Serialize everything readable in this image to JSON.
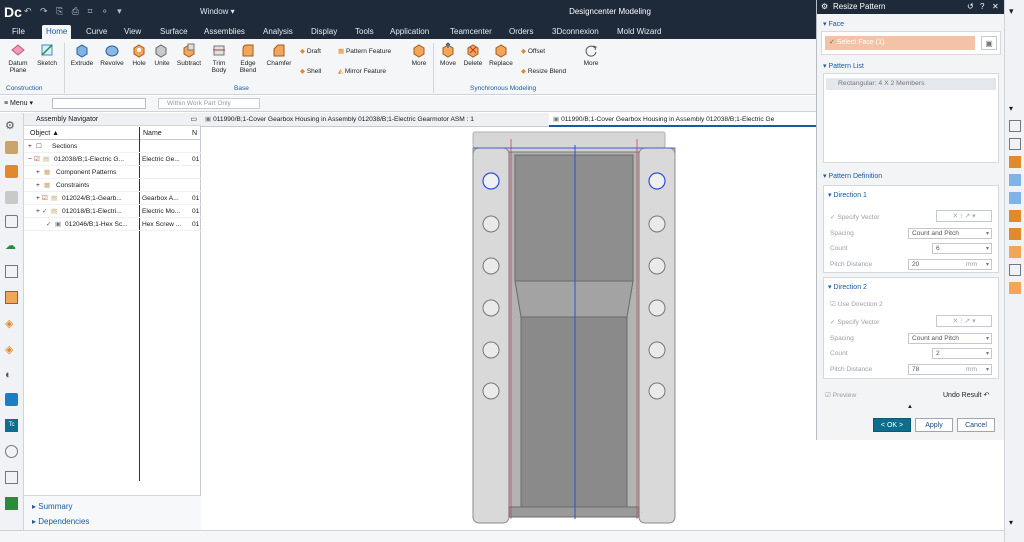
{
  "app": {
    "logo": "Dc",
    "title": "Designcenter Modeling",
    "window_menu": "Window ▾",
    "quick_access": "↶ ↷ ⎘ ⎙ ⌗ ⚬ ▾"
  },
  "menu": {
    "items": [
      "File",
      "Home",
      "Curve",
      "View",
      "Surface",
      "Assemblies",
      "Analysis",
      "Display",
      "Tools",
      "Application",
      "Teamcenter",
      "Orders",
      "3Dconnexion",
      "Mold Wizard"
    ],
    "active": "Home"
  },
  "ribbon": {
    "construction": {
      "label": "Construction",
      "datum_plane": "Datum Plane",
      "sketch": "Sketch"
    },
    "base": {
      "label": "Base",
      "extrude": "Extrude",
      "revolve": "Revolve",
      "hole": "Hole",
      "unite": "Unite",
      "subtract": "Subtract",
      "trim_body": "Trim Body",
      "edge_blend": "Edge Blend",
      "chamfer": "Chamfer",
      "draft": "Draft",
      "shell": "Shell",
      "pattern_feature": "Pattern Feature",
      "mirror_feature": "Mirror Feature",
      "more": "More"
    },
    "sync": {
      "label": "Synchronous Modeling",
      "move": "Move",
      "delete": "Delete",
      "replace": "Replace",
      "offset": "Offset",
      "resize_blend": "Resize Blend",
      "more": "More"
    }
  },
  "filterbar": {
    "menu": "Menu",
    "work_part": "Within Work Part Only"
  },
  "navigator": {
    "title": "Assembly Navigator",
    "col_object": "Object",
    "col_name": "Name",
    "col_n": "N",
    "rows": [
      {
        "object": "Sections",
        "name": "",
        "n": ""
      },
      {
        "object": "012038/B;1-Electric G...",
        "name": "Electric Ge...",
        "n": "01"
      },
      {
        "object": "Component Patterns",
        "name": "",
        "n": ""
      },
      {
        "object": "Constraints",
        "name": "",
        "n": ""
      },
      {
        "object": "012024/B;1-Gearb...",
        "name": "Gearbox A...",
        "n": "01"
      },
      {
        "object": "012018/B;1-Electri...",
        "name": "Electric Mo...",
        "n": "01"
      },
      {
        "object": "012046/B;1-Hex Sc...",
        "name": "Hex Screw ...",
        "n": "01"
      }
    ],
    "summary": "Summary",
    "dependencies": "Dependencies"
  },
  "tabs": [
    {
      "label": "011990/B;1-Cover Gearbox Housing in Assembly 012038/B;1-Electric Gearmotor ASM : 1"
    },
    {
      "label": "011990/B;1-Cover Gearbox Housing in Assembly 012038/B;1-Electric Ge"
    }
  ],
  "dialog": {
    "title": "Resize Pattern",
    "face_section": "Face",
    "select_face": "Select Face (1)",
    "pattern_list_section": "Pattern List",
    "pattern_item": "Rectangular: 4 X 2 Members",
    "pattern_definition": "Pattern Definition",
    "direction1": {
      "label": "Direction 1",
      "specify_vector": "Specify Vector",
      "spacing_label": "Spacing",
      "spacing_value": "Count and Pitch",
      "count_label": "Count",
      "count_value": "6",
      "pitch_label": "Pitch Distance",
      "pitch_value": "20",
      "pitch_unit": "mm"
    },
    "direction2": {
      "label": "Direction 2",
      "use_direction": "Use Direction 2",
      "specify_vector": "Specify Vector",
      "spacing_label": "Spacing",
      "spacing_value": "Count and Pitch",
      "count_label": "Count",
      "count_value": "2",
      "pitch_label": "Pitch Distance",
      "pitch_value": "78",
      "pitch_unit": "mm"
    },
    "preview": "Preview",
    "undo_result": "Undo Result",
    "ok": "< OK >",
    "apply": "Apply",
    "cancel": "Cancel"
  },
  "colors": {
    "accent": "#1a5aa0",
    "titlebar": "#1e2a3a",
    "ok_button": "#0e6e8e",
    "selection": "#f4c3a7"
  }
}
